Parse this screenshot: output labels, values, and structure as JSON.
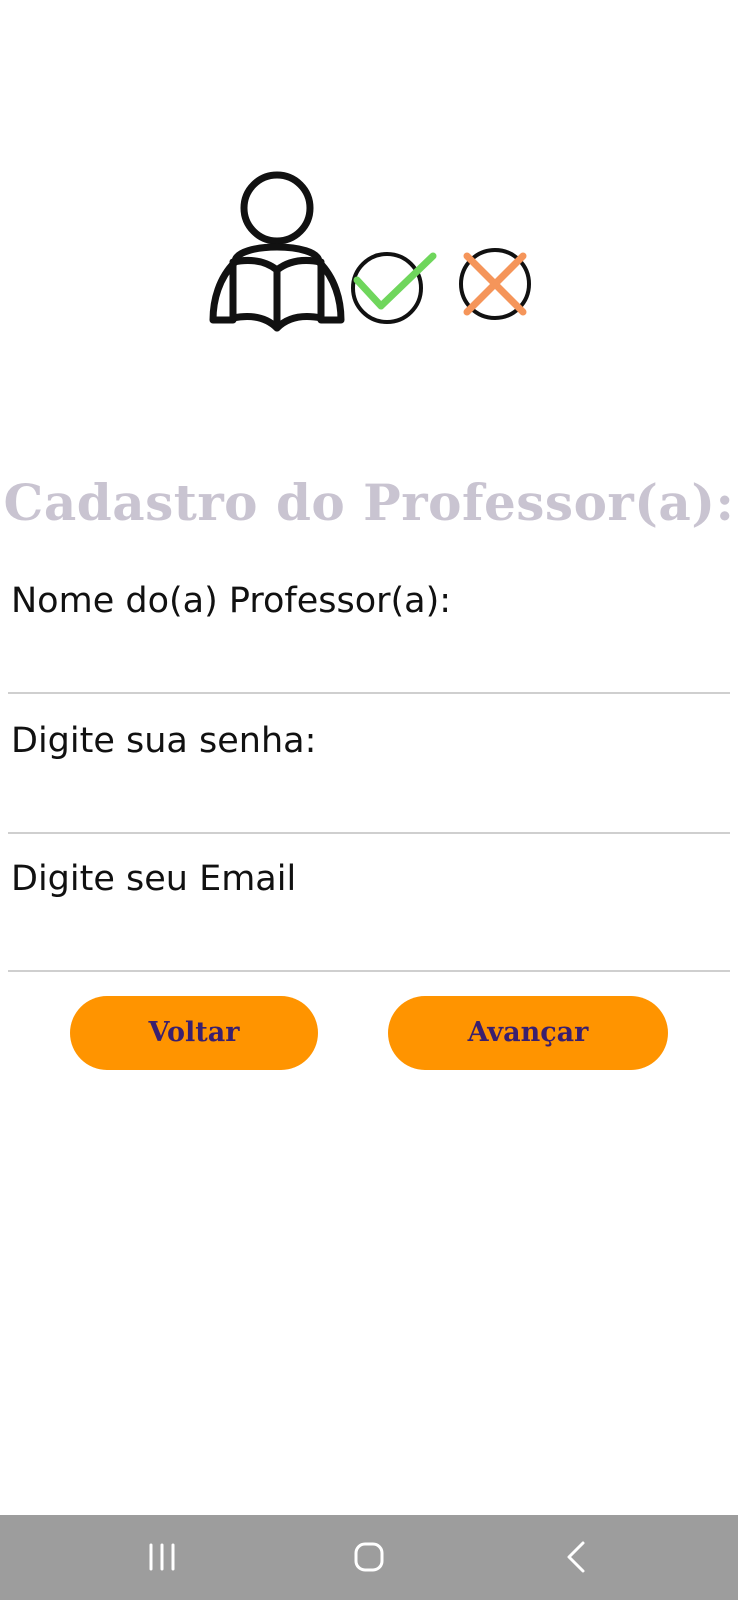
{
  "logo": {
    "icons": [
      "reader-person-icon",
      "check-circle-icon",
      "x-circle-icon"
    ],
    "colors": {
      "outline": "#111111",
      "check": "#6fd65c",
      "cross": "#f5955a"
    }
  },
  "form": {
    "title": "Cadastro do Professor(a):",
    "fields": [
      {
        "label": "Nome do(a) Professor(a):",
        "value": "",
        "placeholder": ""
      },
      {
        "label": "Digite sua senha:",
        "value": "",
        "placeholder": ""
      },
      {
        "label": "Digite seu Email",
        "value": "",
        "placeholder": ""
      }
    ]
  },
  "buttons": {
    "back_label": "Voltar",
    "next_label": "Avançar"
  },
  "colors": {
    "title": "#c9c4d1",
    "button_bg": "#ff9400",
    "button_text": "#3a1f6e",
    "navbar_bg": "#9d9d9d",
    "navbar_icon": "#ffffff"
  },
  "navbar": {
    "icons": [
      "recents-icon",
      "home-icon",
      "back-icon"
    ]
  }
}
